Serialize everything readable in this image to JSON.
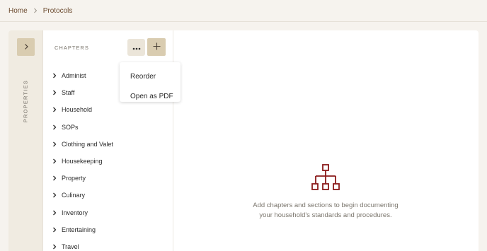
{
  "breadcrumb": {
    "home": "Home",
    "current": "Protocols"
  },
  "properties": {
    "label": "PROPERTIES"
  },
  "chapters": {
    "title": "CHAPTERS",
    "items": [
      "Administ",
      "Staff",
      "Household",
      "SOPs",
      "Clothing and Valet",
      "Housekeeping",
      "Property",
      "Culinary",
      "Inventory",
      "Entertaining",
      "Travel"
    ]
  },
  "menu": {
    "items": [
      "Reorder",
      "Open as PDF"
    ]
  },
  "empty_state": {
    "line1": "Add chapters and sections to begin documenting",
    "line2": "your household's standards and procedures."
  },
  "colors": {
    "accent": "#8b1a1a",
    "button": "#d9ccb0",
    "breadcrumb": "#6b4a2e"
  },
  "icons": {
    "breadcrumb_sep": "chevron-right-icon",
    "properties_toggle": "chevron-right-icon",
    "more": "more-horizontal-icon",
    "add": "plus-icon",
    "chapter": "chevron-right-icon",
    "empty": "sitemap-icon"
  }
}
